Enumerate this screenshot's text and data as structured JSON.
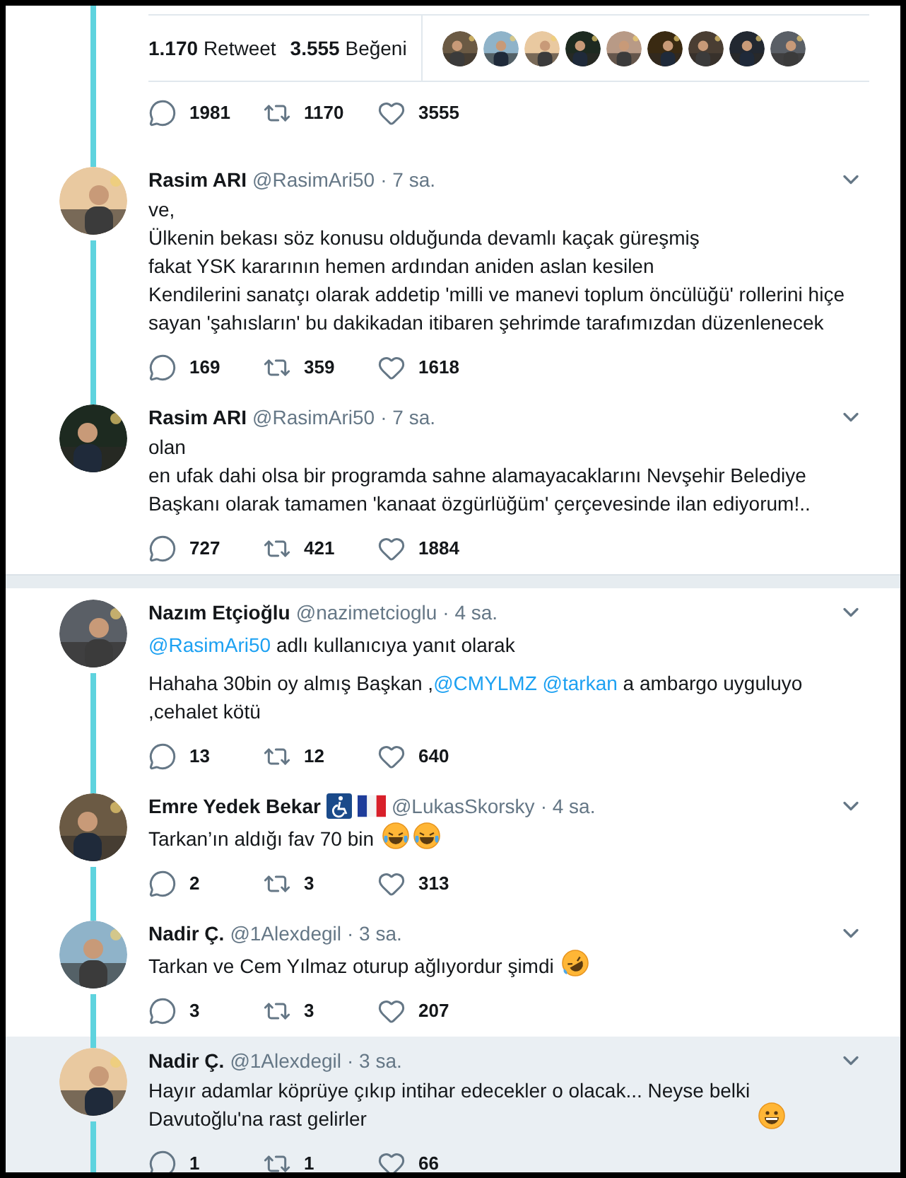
{
  "stats": {
    "retweet_count": "1.170",
    "retweet_label": "Retweet",
    "like_count": "3.555",
    "like_label": "Beğeni"
  },
  "main_actions": {
    "replies": "1981",
    "retweets": "1170",
    "likes": "3555"
  },
  "threads": [
    {
      "tweets": [
        {
          "name": "Rasim ARI",
          "handle": "@RasimAri50",
          "time": "· 7 sa.",
          "thread_above": true,
          "thread_below": true,
          "highlighted": false,
          "lines": [
            [
              {
                "text": "ve,"
              }
            ],
            [
              {
                "text": "Ülkenin bekası söz konusu olduğunda devamlı kaçak güreşmiş"
              }
            ],
            [
              {
                "text": "fakat YSK kararının hemen ardından aniden aslan kesilen"
              }
            ],
            [
              {
                "text": "Kendilerini sanatçı olarak addetip 'milli ve manevi toplum öncülüğü' rollerini hiçe"
              }
            ],
            [
              {
                "text": "sayan 'şahısların' bu dakikadan itibaren şehrimde tarafımızdan düzenlenecek"
              }
            ]
          ],
          "replies": "169",
          "retweets": "359",
          "likes": "1618"
        },
        {
          "name": "Rasim ARI",
          "handle": "@RasimAri50",
          "time": "· 7 sa.",
          "thread_above": true,
          "thread_below": false,
          "highlighted": false,
          "lines": [
            [
              {
                "text": "olan"
              }
            ],
            [
              {
                "text": "en ufak dahi olsa bir programda sahne alamayacaklarını Nevşehir Belediye"
              }
            ],
            [
              {
                "text": "Başkanı olarak tamamen 'kanaat özgürlüğüm' çerçevesinde ilan ediyorum!.."
              }
            ]
          ],
          "replies": "727",
          "retweets": "421",
          "likes": "1884"
        }
      ]
    },
    {
      "tweets": [
        {
          "name": "Nazım Etçioğlu",
          "handle": "@nazimetcioglu",
          "time": "· 4 sa.",
          "thread_above": false,
          "thread_below": true,
          "highlighted": false,
          "reply_to": {
            "handle": "@RasimAri50",
            "text": "adlı kullanıcıya yanıt olarak"
          },
          "lines": [
            [
              {
                "text": "Hahaha 30bin oy almış Başkan ,"
              },
              {
                "text": "@CMYLMZ",
                "link": true
              },
              {
                "text": "@tarkan",
                "link": true
              },
              {
                "text": " a ambargo uyguluyo"
              }
            ],
            [
              {
                "text": ",cehalet kötü"
              }
            ]
          ],
          "replies": "13",
          "retweets": "12",
          "likes": "640"
        },
        {
          "name": "Emre Yedek Bekar",
          "badges": [
            {
              "kind": "wheelchair"
            },
            {
              "kind": "flag"
            }
          ],
          "handle": "@LukasSkorsky",
          "time": "· 4 sa.",
          "thread_above": true,
          "thread_below": true,
          "highlighted": false,
          "lines": [
            [
              {
                "text": "Tarkan’ın aldığı fav 70 bin"
              }
            ]
          ],
          "emoji": [
            {
              "kind": "tears"
            },
            {
              "kind": "tears"
            }
          ],
          "replies": "2",
          "retweets": "3",
          "likes": "313"
        },
        {
          "name": "Nadir Ç.",
          "handle": "@1Alexdegil",
          "time": "· 3 sa.",
          "thread_above": true,
          "thread_below": true,
          "highlighted": false,
          "lines": [
            [
              {
                "text": "Tarkan ve Cem Yılmaz oturup ağlıyordur şimdi"
              }
            ]
          ],
          "emoji": [
            {
              "kind": "rolling"
            }
          ],
          "replies": "3",
          "retweets": "3",
          "likes": "207"
        },
        {
          "name": "Nadir Ç.",
          "handle": "@1Alexdegil",
          "time": "· 3 sa.",
          "thread_above": true,
          "thread_below": true,
          "highlighted": true,
          "lines": [
            [
              {
                "text": "Hayır adamlar köprüye çıkıp intihar edecekler o olacak... Neyse belki"
              }
            ],
            [
              {
                "text": "Davutoğlu'na rast gelirler"
              }
            ]
          ],
          "emoji": [
            {
              "kind": "grin"
            }
          ],
          "replies": "1",
          "retweets": "1",
          "likes": "66"
        }
      ]
    }
  ]
}
